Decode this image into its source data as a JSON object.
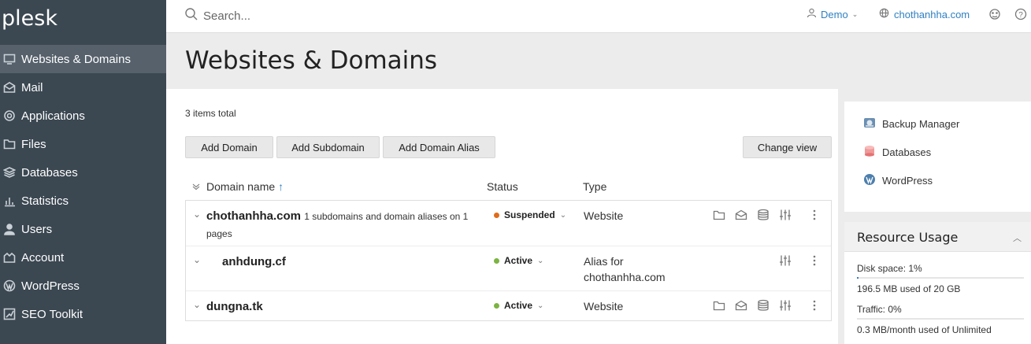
{
  "logo": "plesk",
  "sidebar": {
    "items": [
      {
        "label": "Websites & Domains",
        "icon": "monitor-icon",
        "active": true
      },
      {
        "label": "Mail",
        "icon": "mail-icon"
      },
      {
        "label": "Applications",
        "icon": "gear-icon"
      },
      {
        "label": "Files",
        "icon": "folder-icon"
      },
      {
        "label": "Databases",
        "icon": "layers-icon"
      },
      {
        "label": "Statistics",
        "icon": "bar-chart-icon"
      },
      {
        "label": "Users",
        "icon": "user-icon"
      },
      {
        "label": "Account",
        "icon": "account-icon"
      },
      {
        "label": "WordPress",
        "icon": "wordpress-icon"
      },
      {
        "label": "SEO Toolkit",
        "icon": "seo-icon"
      }
    ]
  },
  "topbar": {
    "search_placeholder": "Search...",
    "user": "Demo",
    "domain": "chothanhha.com"
  },
  "page": {
    "title": "Websites & Domains",
    "items_total": "3 items total"
  },
  "toolbar": {
    "add_domain": "Add Domain",
    "add_subdomain": "Add Subdomain",
    "add_alias": "Add Domain Alias",
    "change_view": "Change view"
  },
  "table": {
    "headers": {
      "name": "Domain name",
      "status": "Status",
      "type": "Type"
    },
    "rows": [
      {
        "name": "chothanhha.com",
        "note": "1 subdomains and domain aliases on 1 pages",
        "status": "Suspended",
        "status_color": "#e06c1a",
        "type": "Website"
      },
      {
        "name": "anhdung.cf",
        "note": "",
        "status": "Active",
        "status_color": "#7cb342",
        "type": "Alias for chothanhha.com"
      },
      {
        "name": "dungna.tk",
        "note": "",
        "status": "Active",
        "status_color": "#7cb342",
        "type": "Website"
      }
    ]
  },
  "right_links": [
    {
      "label": "Backup Manager",
      "icon": "backup-icon"
    },
    {
      "label": "Databases",
      "icon": "database-icon"
    },
    {
      "label": "WordPress",
      "icon": "wordpress-icon"
    }
  ],
  "resource_usage": {
    "title": "Resource Usage",
    "disk_label": "Disk space:",
    "disk_value": "1%",
    "disk_fraction": 0.01,
    "disk_detail": "196.5 MB used of 20 GB",
    "traffic_label": "Traffic:",
    "traffic_value": "0%",
    "traffic_detail": "0.3 MB/month used of Unlimited"
  },
  "colors": {
    "sidebar_bg": "#3b4751",
    "accent": "#2f80c1"
  }
}
